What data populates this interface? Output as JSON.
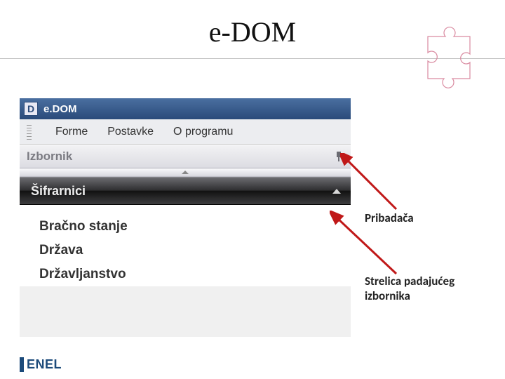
{
  "slide": {
    "title": "e-DOM"
  },
  "app": {
    "titlebar": {
      "icon_letter": "D",
      "title": "e.DOM"
    },
    "menubar": {
      "items": [
        "Forme",
        "Postavke",
        "O programu"
      ]
    },
    "panel": {
      "title": "Izbornik"
    },
    "category": {
      "title": "Šifrarnici"
    },
    "nav_items": [
      "Bračno stanje",
      "Država",
      "Državljanstvo"
    ]
  },
  "callouts": {
    "pin": "Pribadača",
    "dropdown": "Strelica padajućeg izbornika"
  },
  "footer": {
    "logo": "ENEL"
  }
}
